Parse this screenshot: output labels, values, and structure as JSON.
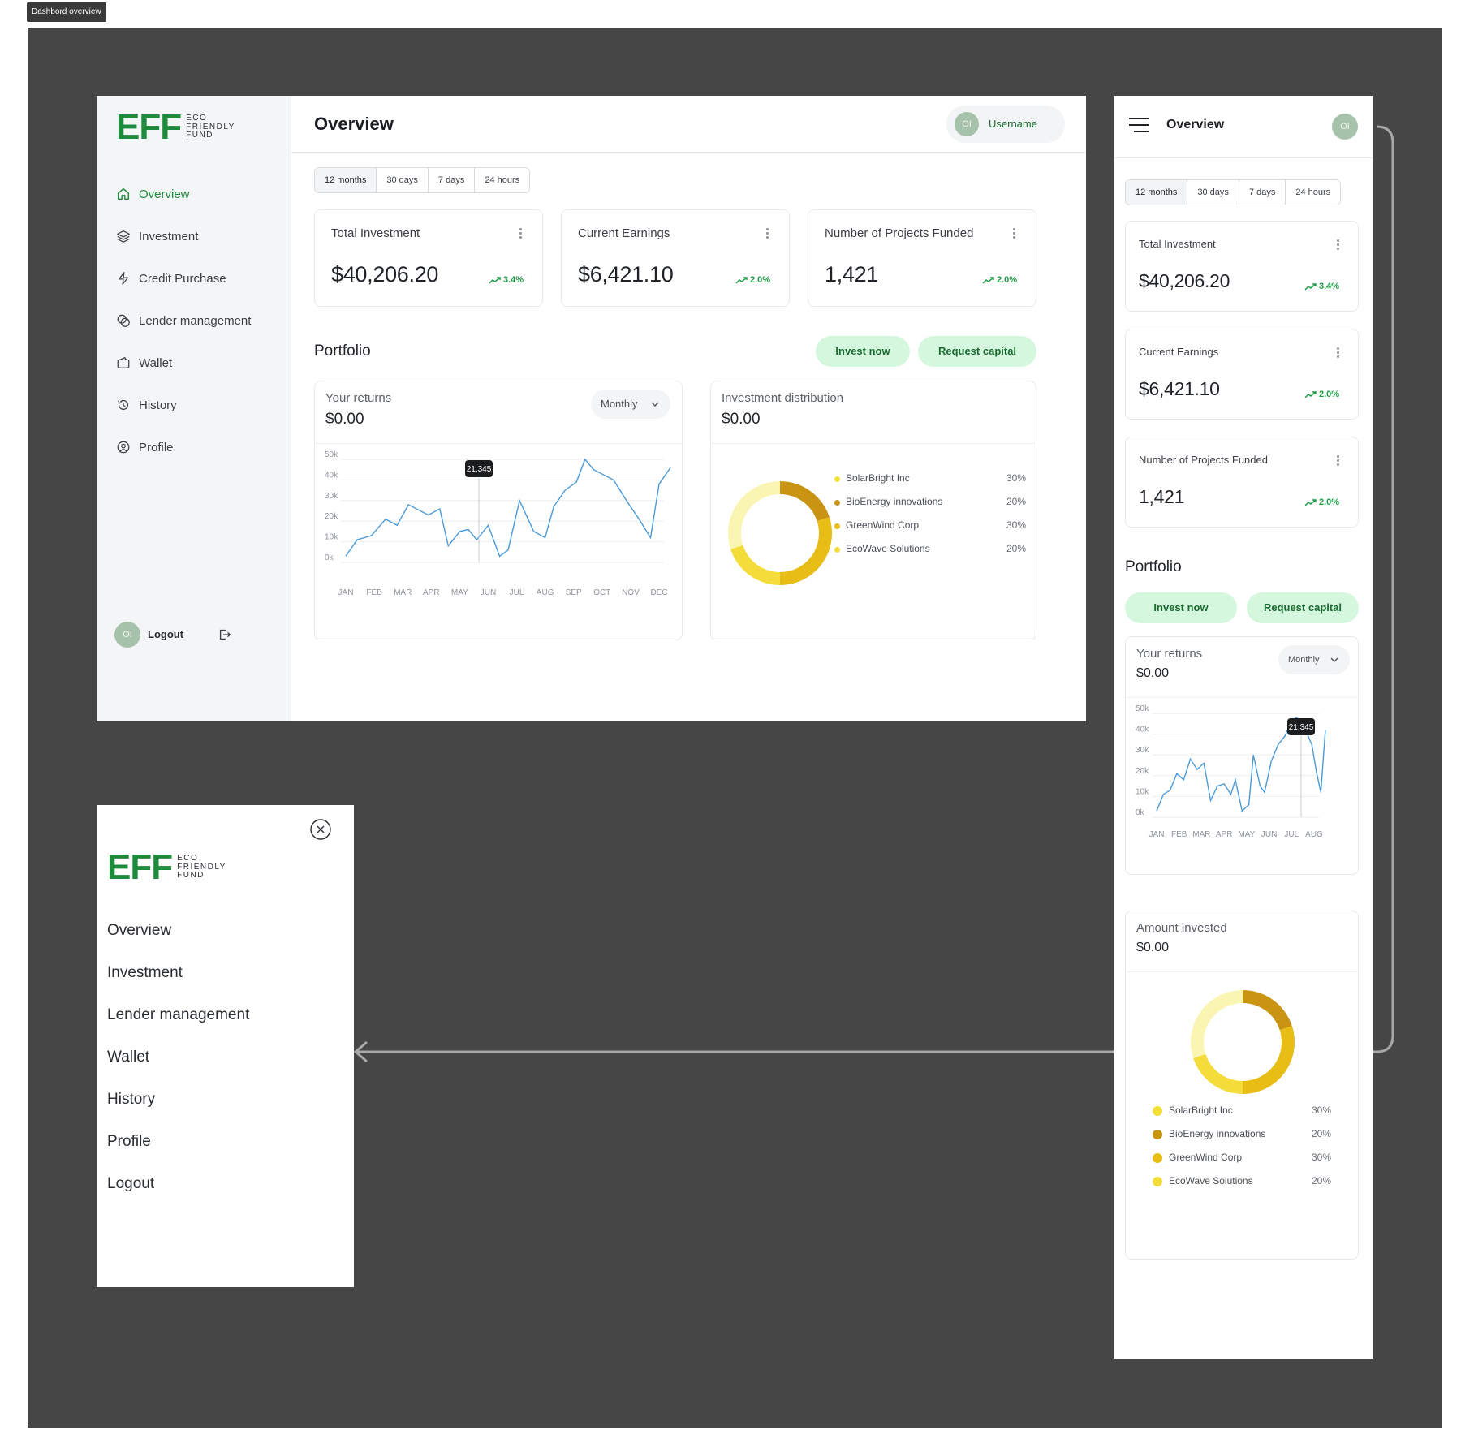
{
  "frame_label": "Dashbord overview",
  "brand": {
    "mark": "EFF",
    "line1": "ECO",
    "line2": "FRIENDLY",
    "line3": "FUND",
    "color": "#1e8a3c"
  },
  "nav": [
    {
      "label": "Overview",
      "icon": "home-icon"
    },
    {
      "label": "Investment",
      "icon": "layers-icon"
    },
    {
      "label": "Credit Purchase",
      "icon": "bolt-icon"
    },
    {
      "label": "Lender management",
      "icon": "coins-icon"
    },
    {
      "label": "Wallet",
      "icon": "wallet-icon"
    },
    {
      "label": "History",
      "icon": "history-icon"
    },
    {
      "label": "Profile",
      "icon": "user-circle-icon"
    }
  ],
  "logout": {
    "avatar": "OI",
    "label": "Logout"
  },
  "header": {
    "title": "Overview",
    "avatar": "OI",
    "username": "Username"
  },
  "ranges": [
    "12 months",
    "30 days",
    "7 days",
    "24 hours"
  ],
  "stats": [
    {
      "title": "Total Investment",
      "value": "$40,206.20",
      "trend": "3.4%"
    },
    {
      "title": "Current Earnings",
      "value": "$6,421.10",
      "trend": "2.0%"
    },
    {
      "title": "Number of Projects Funded",
      "value": "1,421",
      "trend": "2.0%"
    }
  ],
  "portfolio": {
    "title": "Portfolio",
    "invest_label": "Invest now",
    "request_label": "Request capital"
  },
  "returns_card": {
    "title": "Your returns",
    "value": "$0.00",
    "period": "Monthly",
    "tooltip": "21,345"
  },
  "distribution_card": {
    "title": "Investment distribution",
    "value": "$0.00"
  },
  "amount_card": {
    "title": "Amount invested",
    "value": "$0.00"
  },
  "distribution": [
    {
      "name": "SolarBright Inc",
      "pct": "30%",
      "color": "#f3de3a"
    },
    {
      "name": "BioEnergy innovations",
      "pct": "20%",
      "color": "#c89412"
    },
    {
      "name": "GreenWind Corp",
      "pct": "30%",
      "color": "#e7bd16"
    },
    {
      "name": "EcoWave Solutions",
      "pct": "20%",
      "color": "#f4dc3a"
    }
  ],
  "drawer": {
    "items": [
      "Overview",
      "Investment",
      "Lender management",
      "Wallet",
      "History",
      "Profile",
      "Logout"
    ]
  },
  "colors": {
    "canvas": "#464646",
    "accent": "#1e8a3c",
    "pill_bg": "#d5f7de",
    "line": "#4a9ad8"
  },
  "chart_data": [
    {
      "type": "line",
      "title": "Your returns",
      "xlabel": "",
      "ylabel": "",
      "categories": [
        "JAN",
        "FEB",
        "MAR",
        "APR",
        "MAY",
        "JUN",
        "JUL",
        "AUG",
        "SEP",
        "OCT",
        "NOV",
        "DEC"
      ],
      "yticks": [
        "0k",
        "10k",
        "20k",
        "30k",
        "40k",
        "50k"
      ],
      "ylim": [
        0,
        50000
      ],
      "x": [
        0,
        0.4,
        0.9,
        1.4,
        1.8,
        2.2,
        2.9,
        3.3,
        3.6,
        4.0,
        4.3,
        4.6,
        5.0,
        5.4,
        5.7,
        6.1,
        6.6,
        7.0,
        7.3,
        7.7,
        8.1,
        8.4,
        8.7,
        9.4,
        9.9,
        10.3,
        10.7,
        11.0,
        11.4
      ],
      "values": [
        3000,
        11000,
        13000,
        21000,
        18000,
        28000,
        23000,
        26000,
        8000,
        15000,
        16000,
        11000,
        18000,
        3000,
        6000,
        30000,
        15000,
        12000,
        27000,
        35000,
        39000,
        50000,
        45000,
        40000,
        29000,
        21000,
        12000,
        38000,
        46000
      ],
      "annotation": "21,345"
    },
    {
      "type": "pie",
      "title": "Investment distribution",
      "labels": [
        "SolarBright Inc",
        "BioEnergy innovations",
        "GreenWind Corp",
        "EcoWave Solutions"
      ],
      "values": [
        30,
        20,
        30,
        20
      ]
    },
    {
      "type": "line",
      "title": "Your returns",
      "xlabel": "",
      "ylabel": "",
      "categories": [
        "JAN",
        "FEB",
        "MAR",
        "APR",
        "MAY",
        "JUN",
        "JUL",
        "AUG"
      ],
      "yticks": [
        "0k",
        "10k",
        "20k",
        "30k",
        "40k",
        "50k"
      ],
      "ylim": [
        0,
        50000
      ],
      "x": [
        0,
        0.3,
        0.6,
        0.9,
        1.2,
        1.5,
        1.8,
        2.1,
        2.4,
        2.7,
        3.0,
        3.3,
        3.5,
        3.8,
        4.1,
        4.3,
        4.6,
        4.8,
        5.1,
        5.4,
        5.7,
        5.9,
        6.2,
        6.5,
        6.7,
        6.9,
        7.1,
        7.3,
        7.5
      ],
      "values": [
        3000,
        11000,
        13000,
        21000,
        18000,
        28000,
        23000,
        26000,
        8000,
        15000,
        16000,
        11000,
        18000,
        3000,
        6000,
        30000,
        15000,
        12000,
        27000,
        35000,
        39000,
        44000,
        48000,
        46000,
        40000,
        35000,
        22000,
        12000,
        42000
      ],
      "annotation": "21,345"
    },
    {
      "type": "pie",
      "title": "Amount invested",
      "labels": [
        "SolarBright Inc",
        "BioEnergy innovations",
        "GreenWind Corp",
        "EcoWave Solutions"
      ],
      "values": [
        30,
        20,
        30,
        20
      ]
    }
  ]
}
